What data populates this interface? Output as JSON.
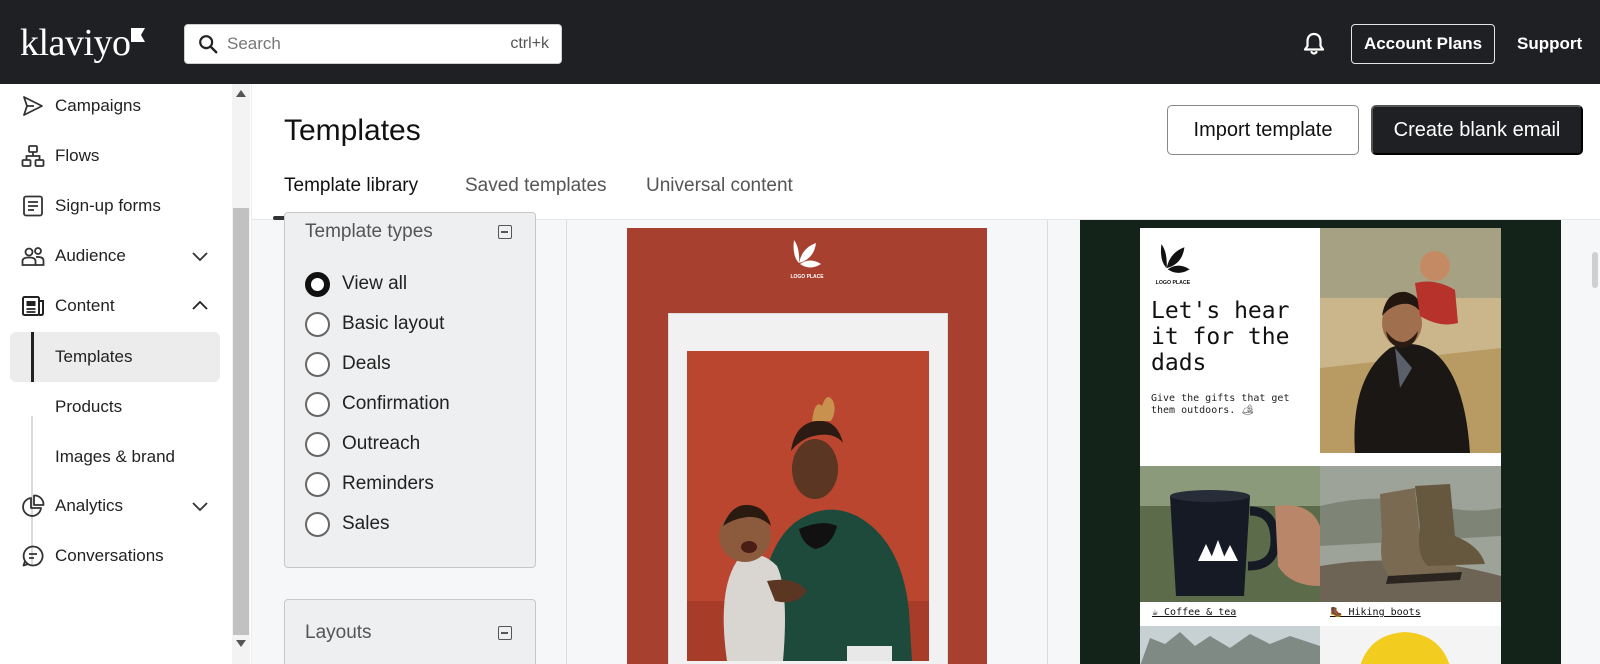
{
  "app": {
    "logo_text": "klaviyo"
  },
  "search": {
    "placeholder": "Search",
    "shortcut": "ctrl+k"
  },
  "topbar": {
    "account_plans_label": "Account Plans",
    "support_label": "Support"
  },
  "sidebar": {
    "items": [
      {
        "label": "Campaigns",
        "icon": "send-icon"
      },
      {
        "label": "Flows",
        "icon": "flow-icon"
      },
      {
        "label": "Sign-up forms",
        "icon": "form-icon"
      },
      {
        "label": "Audience",
        "icon": "people-icon",
        "expandable": true,
        "expanded": false
      },
      {
        "label": "Content",
        "icon": "content-icon",
        "expandable": true,
        "expanded": true
      },
      {
        "label": "Analytics",
        "icon": "pie-chart-icon",
        "expandable": true,
        "expanded": false
      },
      {
        "label": "Conversations",
        "icon": "chat-icon"
      }
    ],
    "content_subitems": [
      {
        "label": "Templates",
        "active": true
      },
      {
        "label": "Products",
        "active": false
      },
      {
        "label": "Images & brand",
        "active": false
      }
    ]
  },
  "main": {
    "title": "Templates",
    "import_label": "Import template",
    "create_label": "Create blank email",
    "tabs": [
      {
        "label": "Template library",
        "active": true
      },
      {
        "label": "Saved templates",
        "active": false
      },
      {
        "label": "Universal content",
        "active": false
      }
    ]
  },
  "filters": {
    "types_title": "Template types",
    "options": [
      {
        "label": "View all",
        "checked": true
      },
      {
        "label": "Basic layout",
        "checked": false
      },
      {
        "label": "Deals",
        "checked": false
      },
      {
        "label": "Confirmation",
        "checked": false
      },
      {
        "label": "Outreach",
        "checked": false
      },
      {
        "label": "Reminders",
        "checked": false
      },
      {
        "label": "Sales",
        "checked": false
      }
    ],
    "layouts_title": "Layouts"
  },
  "templates": [
    {
      "logo_text": "LOGO PLACE",
      "bg_color": "#a8402f"
    },
    {
      "logo_text": "LOGO PLACE",
      "headline": "Let's hear it for the dads",
      "subtext": "Give the gifts that get them outdoors. 🏕",
      "caption_1": "☕ Coffee & tea",
      "caption_2": "🥾 Hiking boots",
      "bg_color": "#13231a"
    }
  ],
  "colors": {
    "topbar": "#1f2023",
    "accent_dark": "#1f2023"
  }
}
